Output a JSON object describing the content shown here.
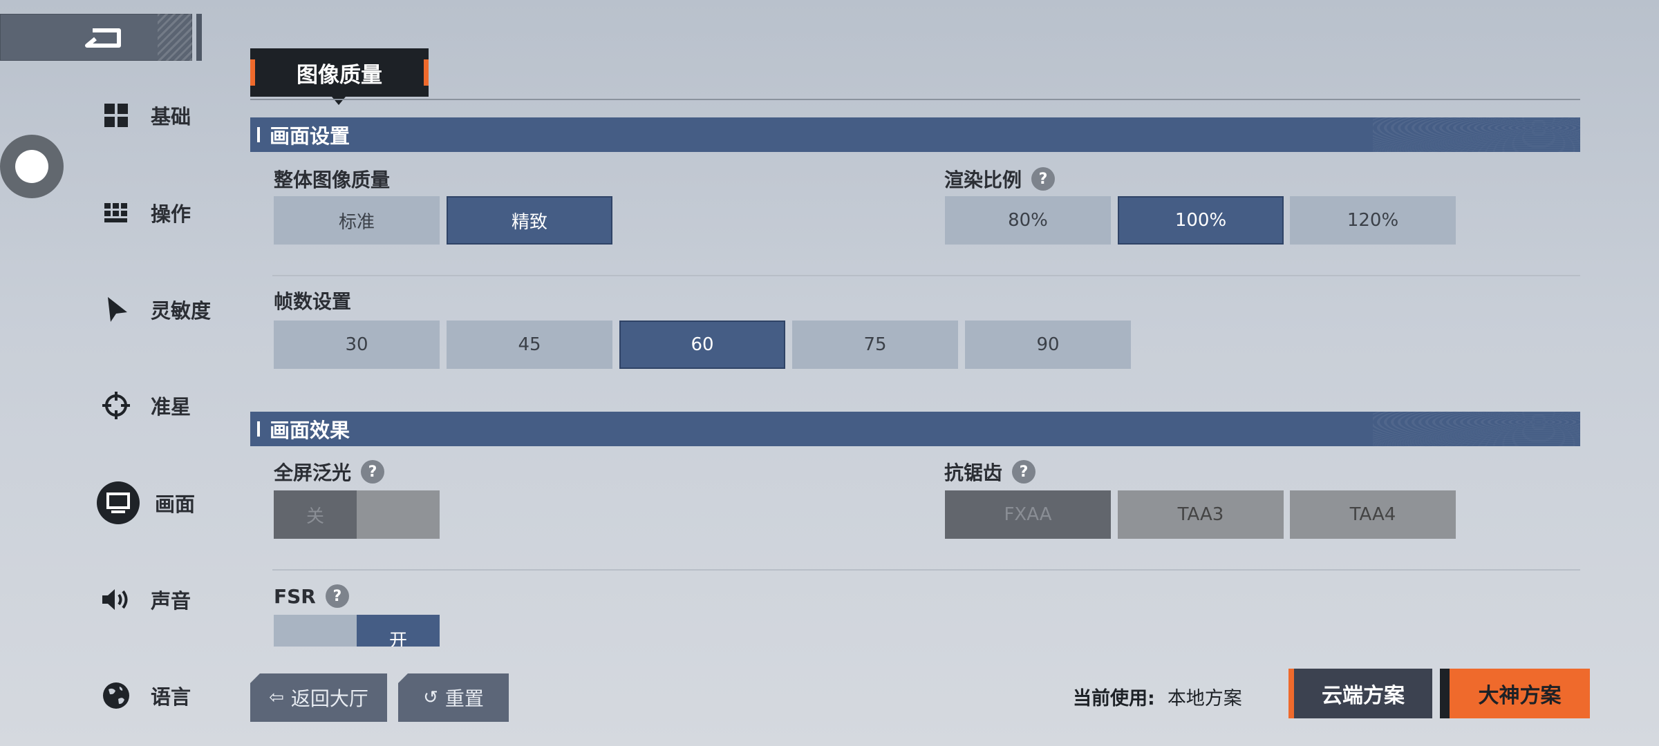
{
  "tab": {
    "label": "图像质量"
  },
  "sidebar": {
    "items": [
      {
        "label": "基础",
        "icon": "grid-icon"
      },
      {
        "label": "操作",
        "icon": "keypad-icon"
      },
      {
        "label": "灵敏度",
        "icon": "cursor-icon"
      },
      {
        "label": "准星",
        "icon": "crosshair-icon"
      },
      {
        "label": "画面",
        "icon": "monitor-icon",
        "active": true
      },
      {
        "label": "声音",
        "icon": "speaker-icon"
      },
      {
        "label": "语言",
        "icon": "globe-icon"
      }
    ]
  },
  "display_settings": {
    "title": "画面设置",
    "overall_quality": {
      "label": "整体图像质量",
      "options": [
        "标准",
        "精致"
      ],
      "selected": "精致"
    },
    "render_scale": {
      "label": "渲染比例",
      "options": [
        "80%",
        "100%",
        "120%"
      ],
      "selected": "100%"
    },
    "frame_rate": {
      "label": "帧数设置",
      "options": [
        "30",
        "45",
        "60",
        "75",
        "90"
      ],
      "selected": "60"
    }
  },
  "display_effects": {
    "title": "画面效果",
    "bloom": {
      "label": "全屏泛光",
      "value": "关"
    },
    "antialiasing": {
      "label": "抗锯齿",
      "options": [
        "FXAA",
        "TAA3",
        "TAA4"
      ],
      "selected": "FXAA"
    },
    "fsr": {
      "label": "FSR",
      "value": "开"
    }
  },
  "bottom": {
    "back_lobby": "返回大厅",
    "reset": "重置",
    "current_label": "当前使用:",
    "current_value": "本地方案",
    "cloud_plan": "云端方案",
    "pro_plan": "大神方案"
  },
  "colors": {
    "accent": "#455d85",
    "orange": "#ef6a2c",
    "dark": "#1d2126"
  }
}
